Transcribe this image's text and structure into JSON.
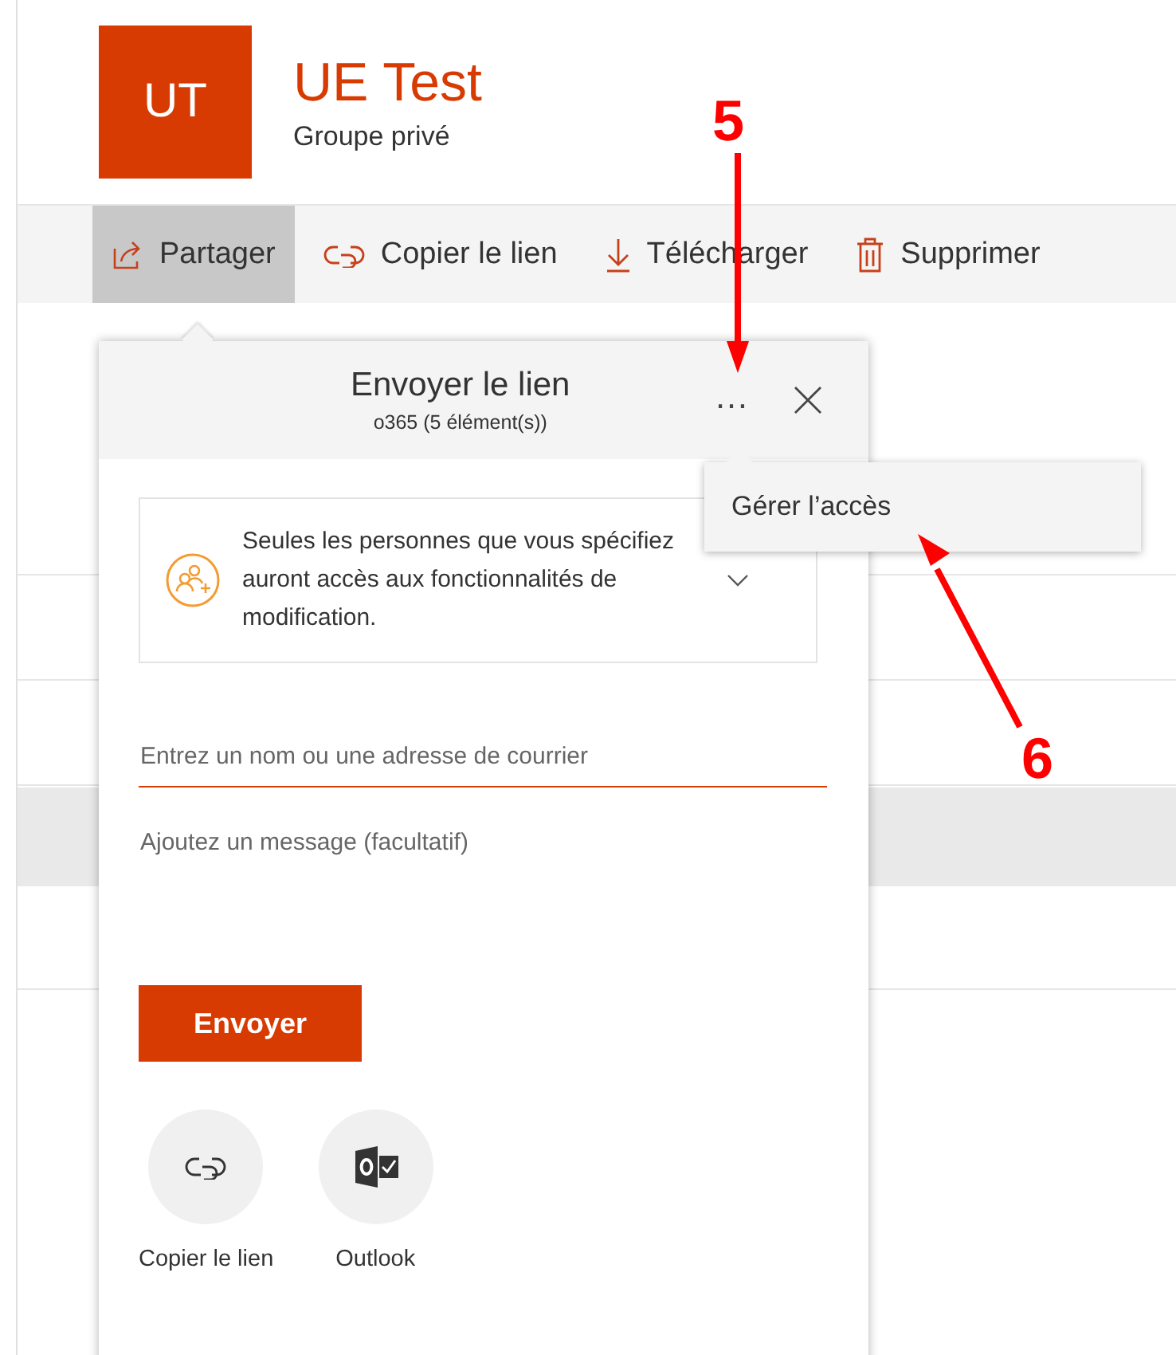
{
  "group": {
    "initials": "UT",
    "name": "UE Test",
    "subtitle": "Groupe privé"
  },
  "toolbar": [
    {
      "label": "Partager",
      "kind": "share",
      "selected": true
    },
    {
      "label": "Copier le lien",
      "kind": "link",
      "selected": false
    },
    {
      "label": "Télécharger",
      "kind": "download",
      "selected": false
    },
    {
      "label": "Supprimer",
      "kind": "trash",
      "selected": false
    }
  ],
  "share_dialog": {
    "title": "Envoyer le lien",
    "subtitle": "o365 (5 élément(s))",
    "more": "…",
    "permission": "Seules les personnes que vous spécifiez auront accès aux fonctionnalités de modification.",
    "recipient_placeholder": "Entrez un nom ou une adresse de courrier",
    "message_placeholder": "Ajoutez un message (facultatif)",
    "send": "Envoyer",
    "options": [
      {
        "label": "Copier le lien",
        "kind": "link"
      },
      {
        "label": "Outlook",
        "kind": "outlook"
      }
    ]
  },
  "more_menu": [
    {
      "label": "Gérer l’accès"
    }
  ],
  "annotations": [
    {
      "label": "5",
      "kind": "down"
    },
    {
      "label": "6",
      "kind": "diagonal"
    }
  ]
}
